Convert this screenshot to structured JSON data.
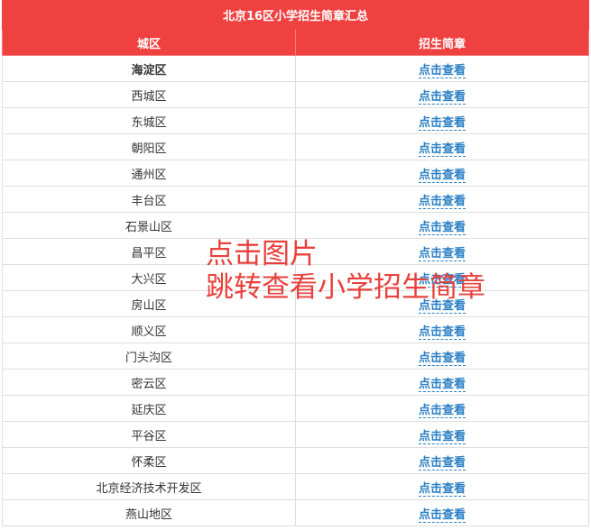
{
  "table": {
    "title": "北京16区小学招生简章汇总",
    "headers": {
      "city": "城区",
      "brochure": "招生简章"
    },
    "link_text": "点击查看",
    "rows": [
      "海淀区",
      "西城区",
      "东城区",
      "朝阳区",
      "通州区",
      "丰台区",
      "石景山区",
      "昌平区",
      "大兴区",
      "房山区",
      "顺义区",
      "门头沟区",
      "密云区",
      "延庆区",
      "平谷区",
      "怀柔区",
      "北京经济技术开发区",
      "燕山地区"
    ]
  },
  "overlay": {
    "line1": "点击图片",
    "line2": "跳转查看小学招生简章"
  },
  "colors": {
    "header_bg": "#f04141",
    "link": "#2a7fc4",
    "overlay_text": "#e8413c"
  }
}
